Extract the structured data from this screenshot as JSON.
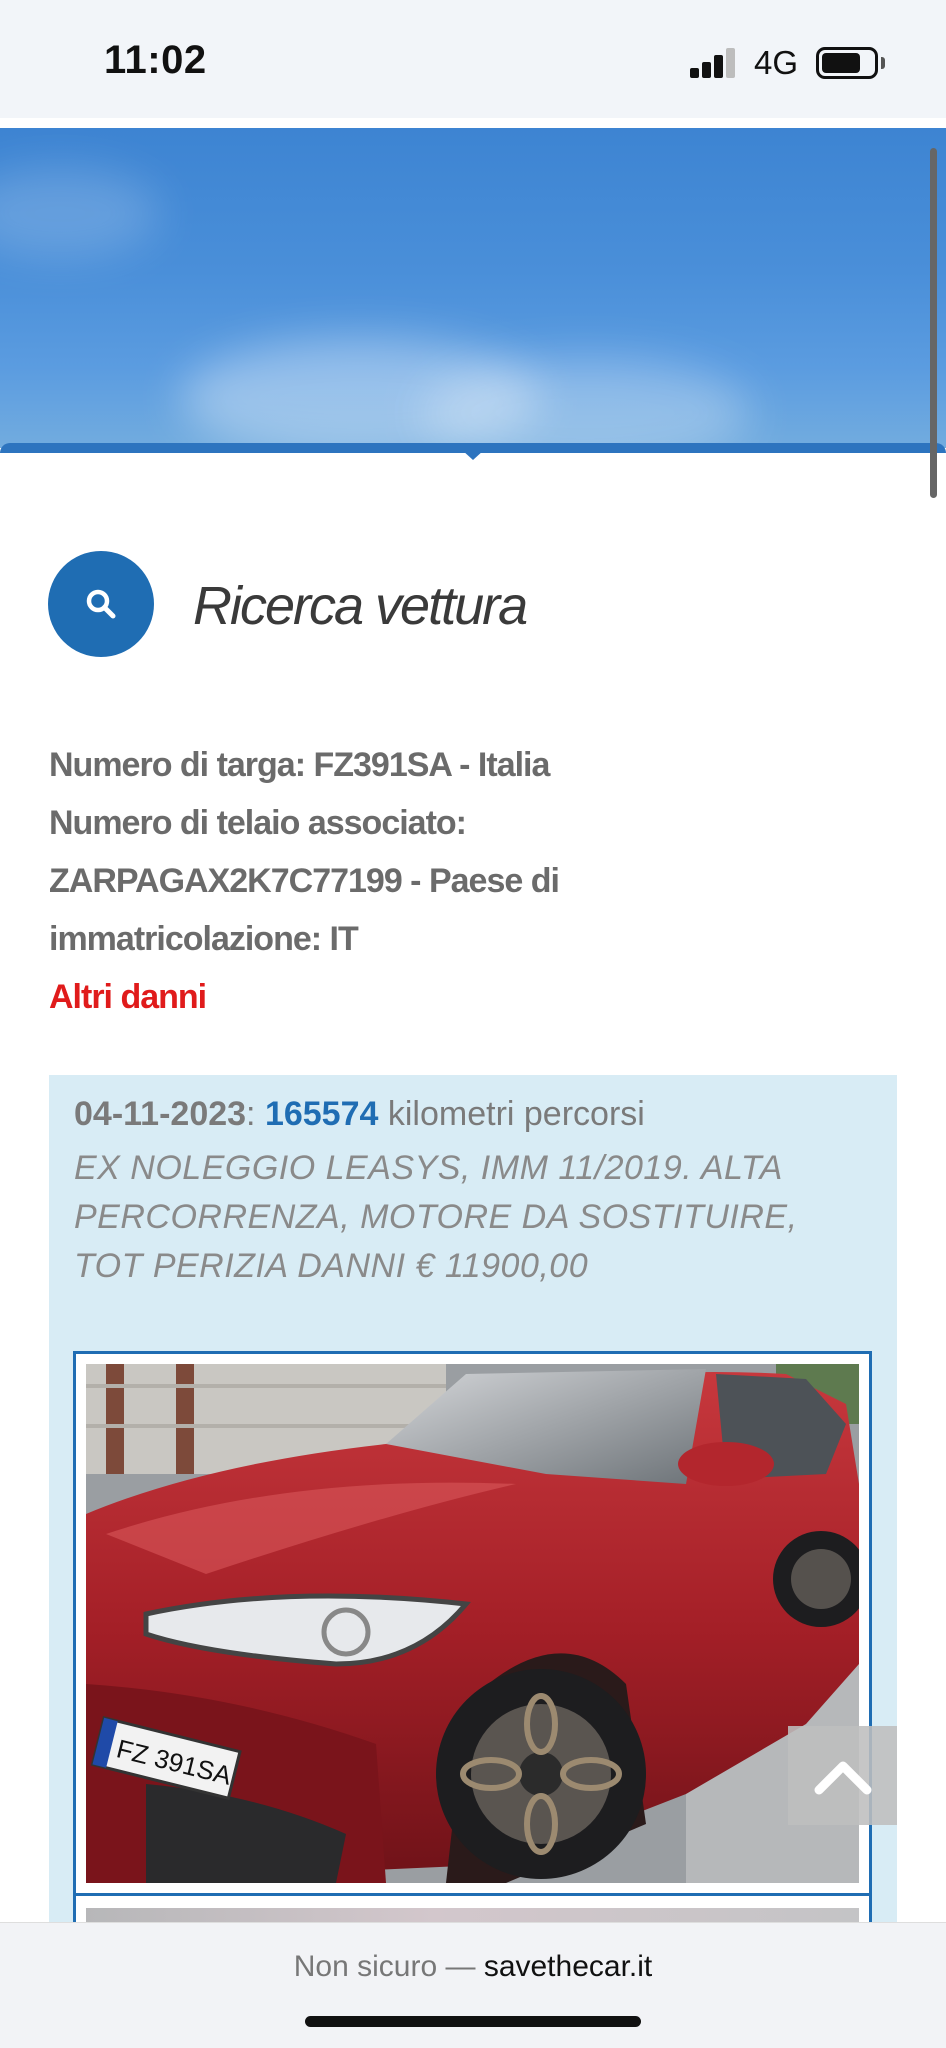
{
  "status_bar": {
    "time": "11:02",
    "network": "4G"
  },
  "search": {
    "title": "Ricerca vettura"
  },
  "vehicle": {
    "plate_line": "Numero di targa: FZ391SA - Italia",
    "chassis_label": "Numero di telaio associato:",
    "chassis_line": "ZARPAGAX2K7C77199 - Paese di",
    "registration_line": "immatricolazione: IT",
    "damage_status": "Altri danni"
  },
  "report": {
    "date": "04-11-2023",
    "date_separator": ":",
    "km_value": "165574",
    "km_label": "kilometri percorsi",
    "description": "EX NOLEGGIO LEASYS, IMM 11/2019. ALTA PERCORRENZA, MOTORE DA SOSTITUIRE, TOT PERIZIA DANNI € 11900,00",
    "photo_plate_text": "FZ 391SA"
  },
  "browser": {
    "security_text": "Non sicuro — ",
    "host": "savethecar.it"
  },
  "colors": {
    "accent": "#1f6db3",
    "damage": "#e01b1b",
    "card_bg": "#d8ecf5"
  },
  "icons": [
    "search-icon",
    "chevron-up-icon",
    "battery-icon",
    "signal-icon"
  ]
}
